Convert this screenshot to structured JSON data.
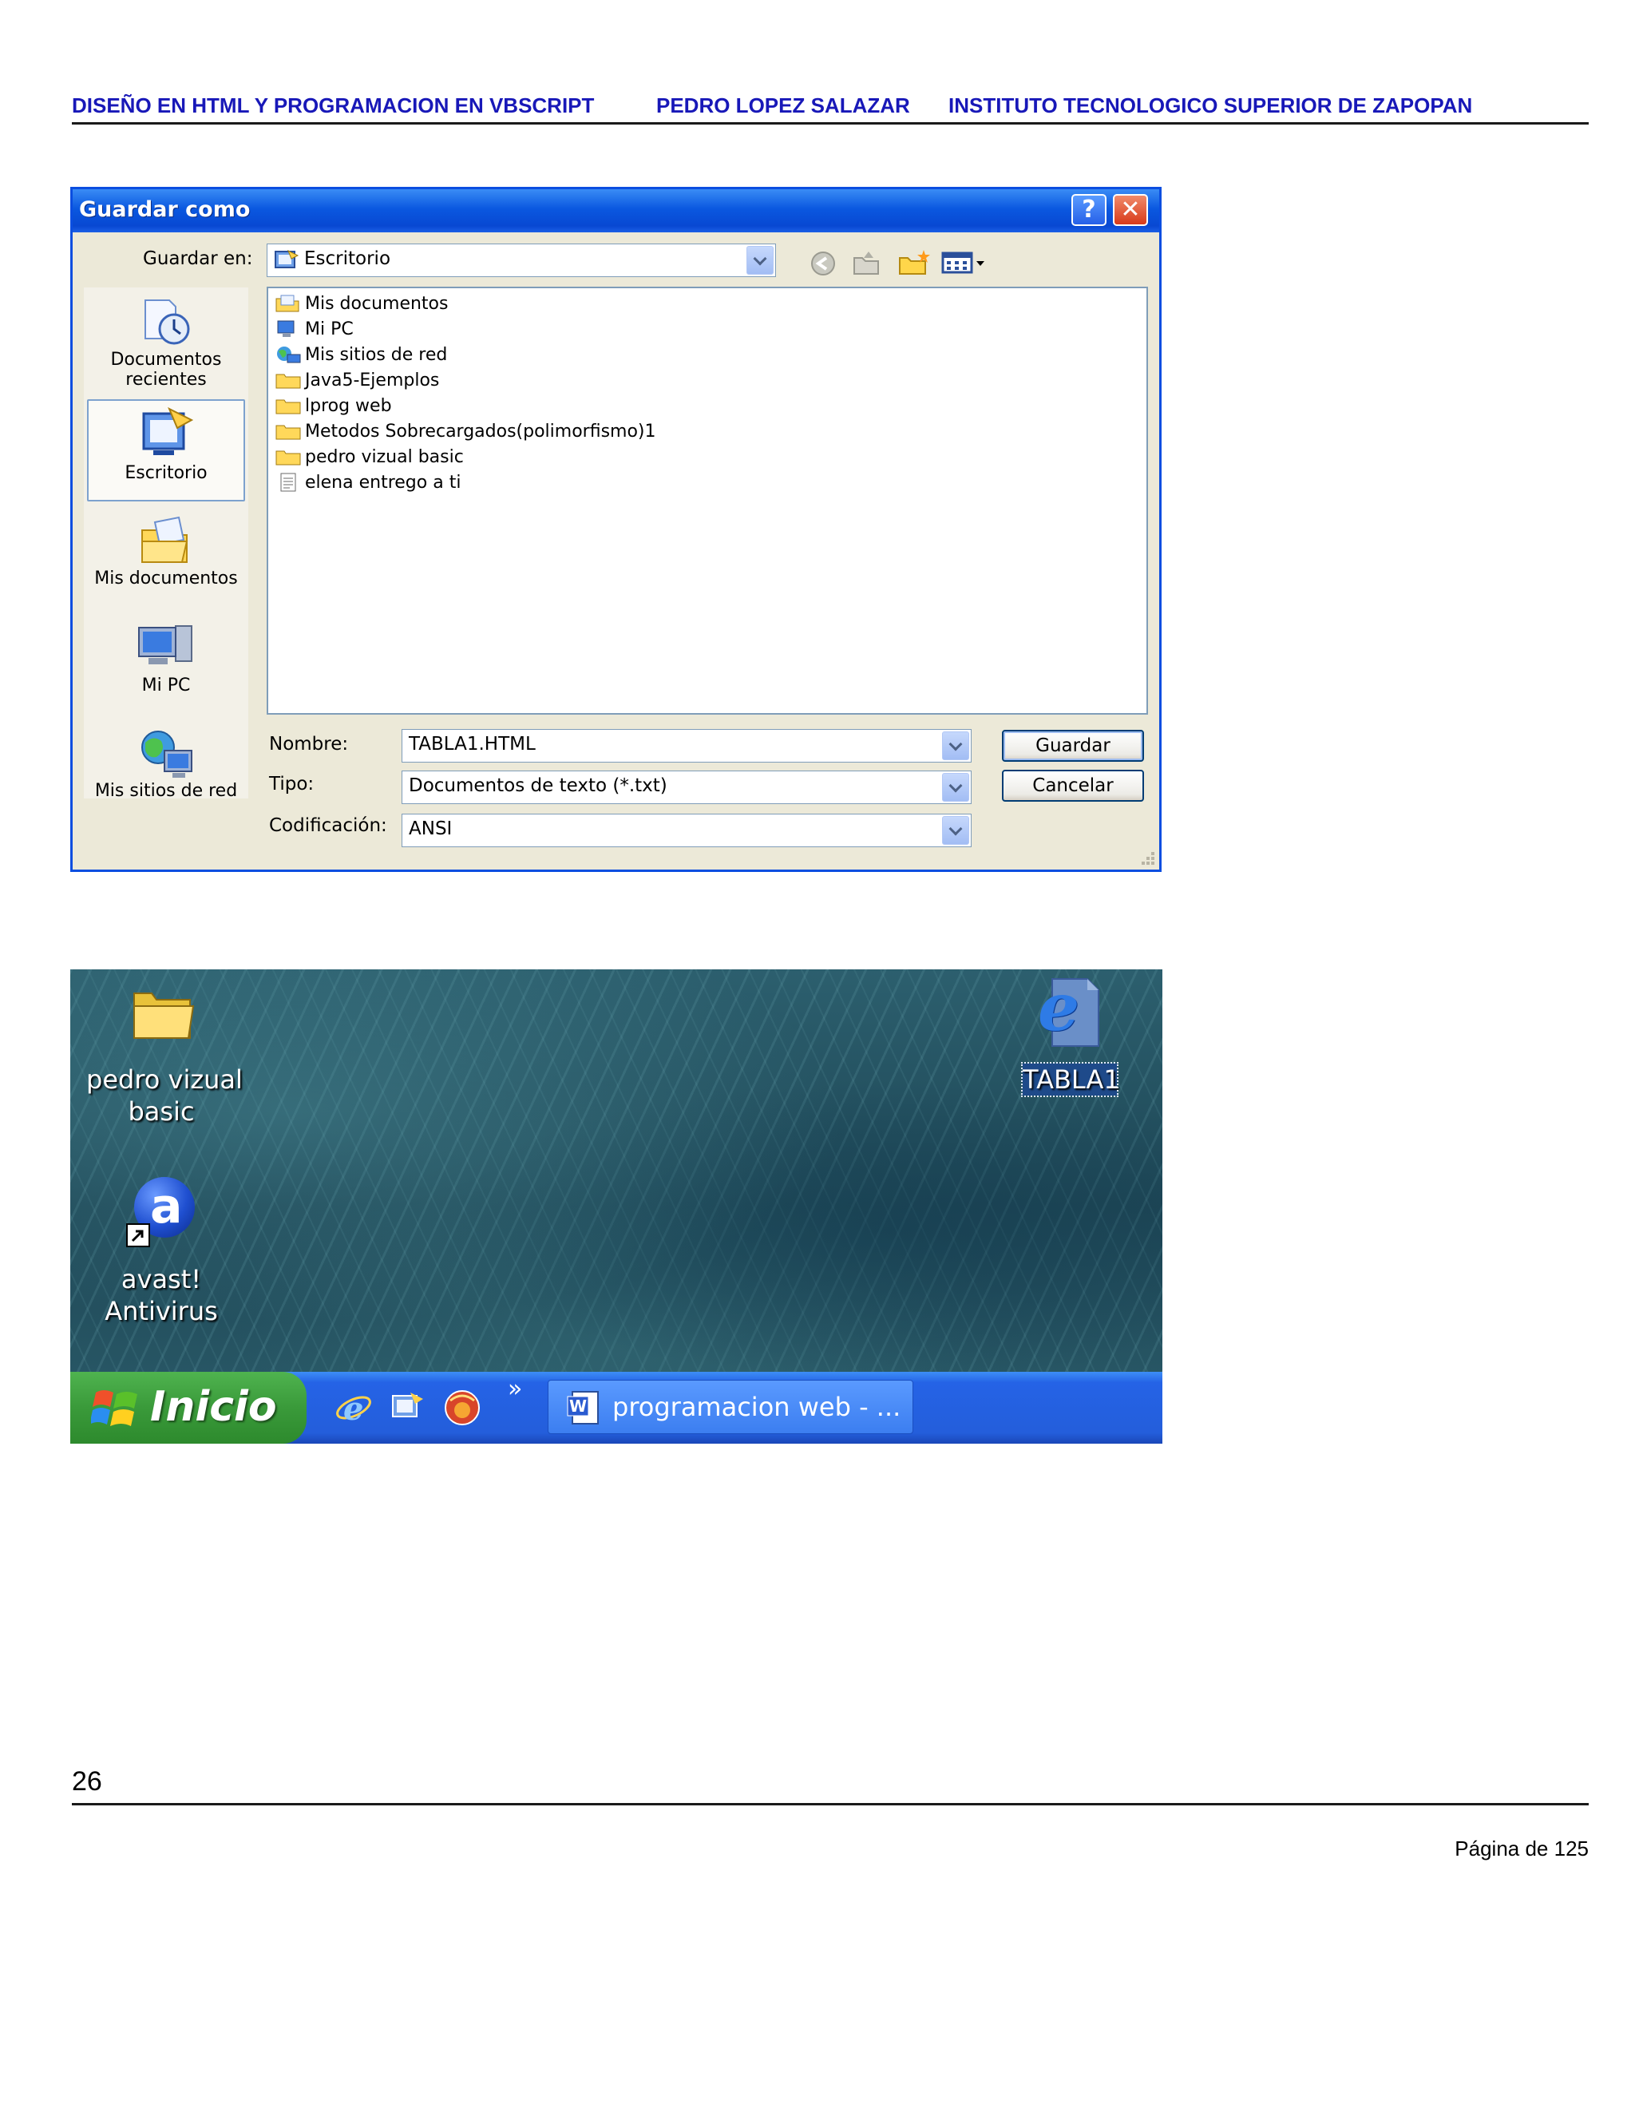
{
  "header": {
    "left": "DISEÑO EN HTML Y PROGRAMACION EN  VBSCRIPT",
    "center": "PEDRO LOPEZ SALAZAR",
    "right": "INSTITUTO  TECNOLOGICO SUPERIOR DE ZAPOPAN"
  },
  "dialog": {
    "title": "Guardar como",
    "help_glyph": "?",
    "close_glyph": "✕",
    "save_in_label": "Guardar en:",
    "save_in_value": "Escritorio",
    "places": [
      {
        "label_line1": "Documentos",
        "label_line2": "recientes"
      },
      {
        "label": "Escritorio"
      },
      {
        "label": "Mis documentos"
      },
      {
        "label": "Mi PC"
      },
      {
        "label": "Mis sitios de red"
      }
    ],
    "files": [
      {
        "name": "Mis documentos",
        "icon": "my-documents-icon"
      },
      {
        "name": "Mi PC",
        "icon": "computer-icon"
      },
      {
        "name": "Mis sitios de red",
        "icon": "network-places-icon"
      },
      {
        "name": "Java5-Ejemplos",
        "icon": "folder-icon"
      },
      {
        "name": "lprog web",
        "icon": "folder-icon"
      },
      {
        "name": "Metodos Sobrecargados(polimorfismo)1",
        "icon": "folder-icon"
      },
      {
        "name": "pedro vizual basic",
        "icon": "folder-icon"
      },
      {
        "name": "elena entrego a ti",
        "icon": "text-file-icon"
      }
    ],
    "name_label": "Nombre:",
    "name_value": "TABLA1.HTML",
    "type_label": "Tipo:",
    "type_value": "Documentos de texto (*.txt)",
    "encoding_label": "Codificación:",
    "encoding_value": "ANSI",
    "save_button": "Guardar",
    "cancel_button": "Cancelar"
  },
  "desktop": {
    "icons": [
      {
        "line1": "pedro vizual",
        "line2": "basic",
        "icon": "folder-icon"
      },
      {
        "line1": "avast!",
        "line2": "Antivirus",
        "icon": "avast-icon"
      },
      {
        "line1": "TABLA1",
        "icon": "html-document-icon"
      }
    ],
    "avast_glyph": "a",
    "ie_glyph": "e",
    "start_label": "Inicio",
    "quicklaunch_more": "»",
    "task_label": "programacion web - ...",
    "word_glyph": "W"
  },
  "footer": {
    "page_number": "26",
    "page_of": "Página  de 125"
  }
}
